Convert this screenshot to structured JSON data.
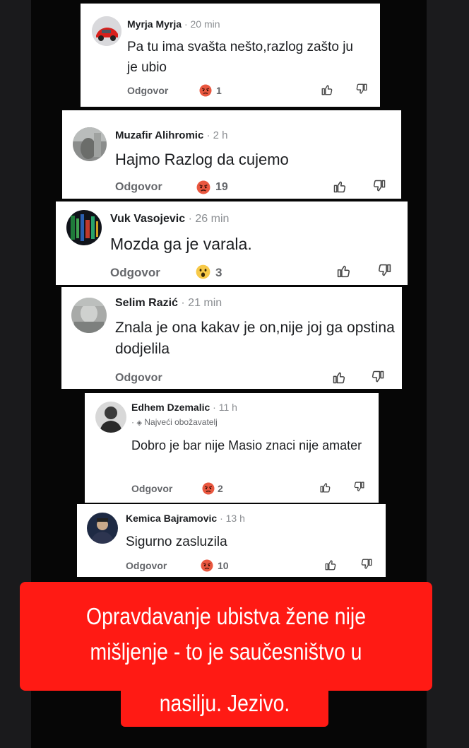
{
  "comments": [
    {
      "name": "Myrja Myrja",
      "time": "20 min",
      "text": "Pa tu ima svašta nešto,razlog zašto ju je ubio",
      "reply": "Odgovor",
      "reaction_icon": "angry-face-icon",
      "reaction_count": "1"
    },
    {
      "name": "Muzafir Alihromic",
      "time": "2 h",
      "text": "Hajmo Razlog da cujemo",
      "reply": "Odgovor",
      "reaction_icon": "angry-face-icon",
      "reaction_count": "19"
    },
    {
      "name": "Vuk Vasojevic",
      "time": "26 min",
      "text": "Mozda ga je varala.",
      "reply": "Odgovor",
      "reaction_icon": "wow-face-icon",
      "reaction_count": "3"
    },
    {
      "name": "Selim Razić",
      "time": "21 min",
      "text": "Znala je ona kakav je on,nije joj ga opstina dodjelila",
      "reply": "Odgovor",
      "reaction_icon": "",
      "reaction_count": ""
    },
    {
      "name": "Edhem Dzemalic",
      "time": "11 h",
      "badge": "Najveći obožavatelj",
      "text": "Dobro je bar nije Masio znaci nije amater",
      "reply": "Odgovor",
      "reaction_icon": "angry-face-icon",
      "reaction_count": "2"
    },
    {
      "name": "Kemica Bajramovic",
      "time": "13 h",
      "text": "Sigurno zasluzila",
      "reply": "Odgovor",
      "reaction_icon": "angry-face-icon",
      "reaction_count": "10"
    }
  ],
  "separator": "·",
  "banner": {
    "lines": [
      "Opravdavanje ubistva žene nije",
      "mišljenje - to je saučesništvo u",
      "nasilju. Jezivo."
    ]
  },
  "colors": {
    "banner": "#ff1a14",
    "reply_text": "#65676b",
    "timestamp": "#8a8d91"
  }
}
